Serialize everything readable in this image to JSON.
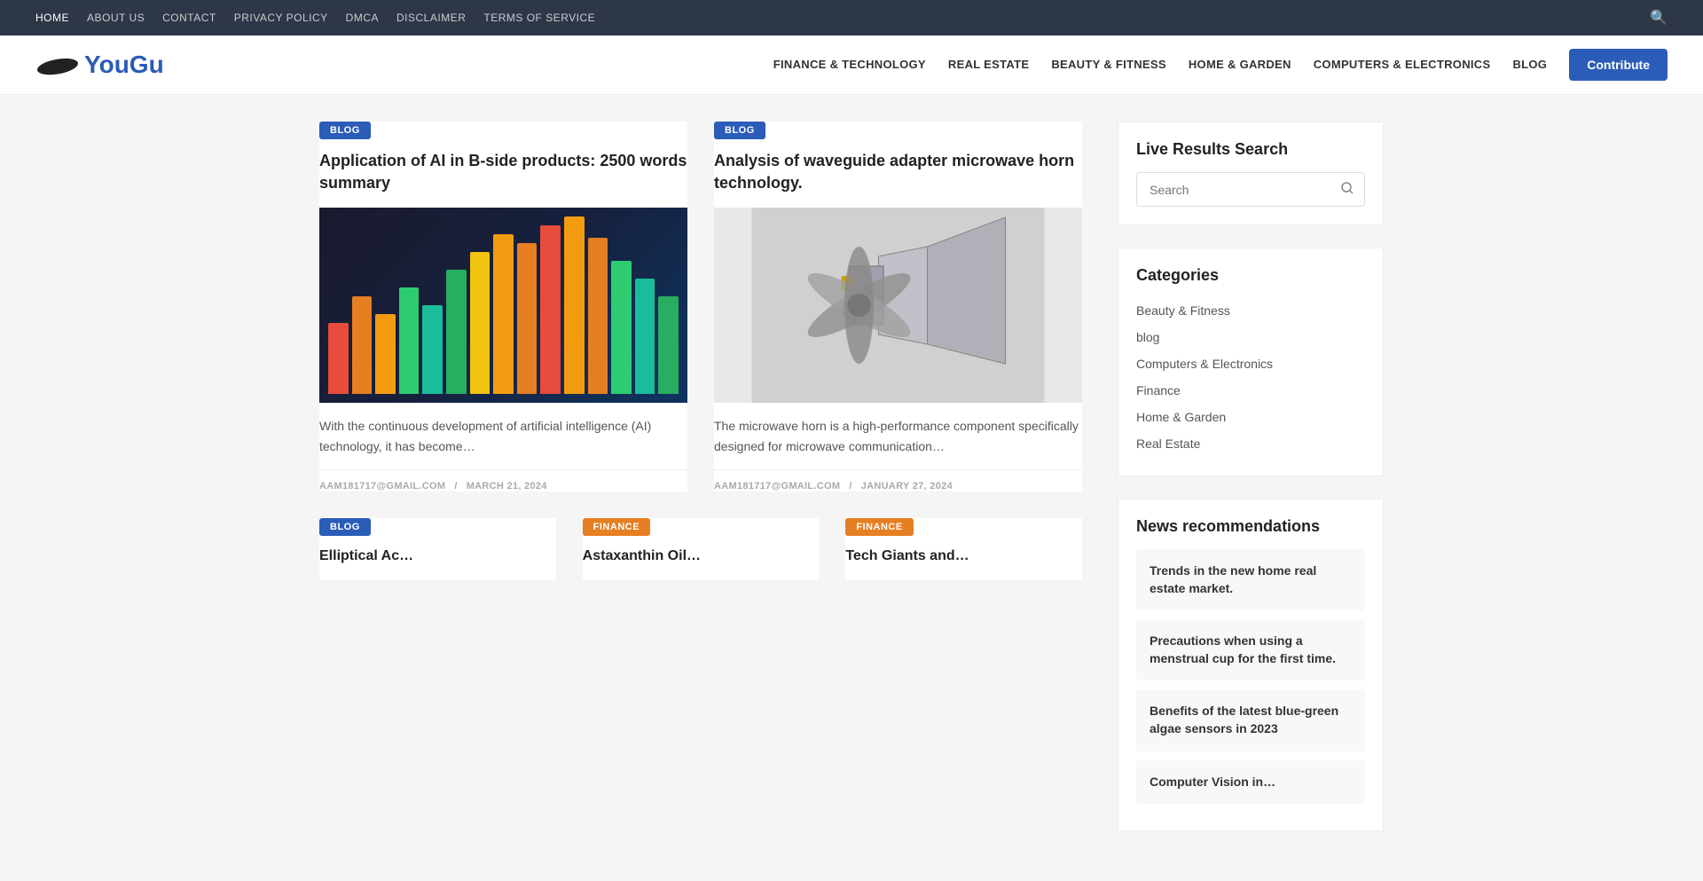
{
  "topnav": {
    "links": [
      {
        "label": "HOME",
        "href": "#",
        "active": true
      },
      {
        "label": "ABOUT US",
        "href": "#",
        "active": false
      },
      {
        "label": "CONTACT",
        "href": "#",
        "active": false
      },
      {
        "label": "PRIVACY POLICY",
        "href": "#",
        "active": false
      },
      {
        "label": "DMCA",
        "href": "#",
        "active": false
      },
      {
        "label": "DISCLAIMER",
        "href": "#",
        "active": false
      },
      {
        "label": "TERMS OF SERVICE",
        "href": "#",
        "active": false
      }
    ]
  },
  "header": {
    "logo_text": "YouGu",
    "nav_items": [
      {
        "label": "FINANCE & TECHNOLOGY",
        "href": "#"
      },
      {
        "label": "REAL ESTATE",
        "href": "#"
      },
      {
        "label": "BEAUTY & FITNESS",
        "href": "#"
      },
      {
        "label": "HOME & GARDEN",
        "href": "#"
      },
      {
        "label": "COMPUTERS & ELECTRONICS",
        "href": "#"
      },
      {
        "label": "BLOG",
        "href": "#"
      }
    ],
    "contribute_label": "Contribute"
  },
  "articles": {
    "top": [
      {
        "badge": "BLOG",
        "badge_type": "blog",
        "title": "Application of AI in B-side products: 2500 words summary",
        "excerpt": "With the continuous development of artificial intelligence (AI) technology, it has become…",
        "author": "AAM181717@GMAIL.COM",
        "date": "MARCH 21, 2024"
      },
      {
        "badge": "BLOG",
        "badge_type": "blog",
        "title": "Analysis of waveguide adapter microwave horn technology.",
        "excerpt": "The microwave horn is a high-performance component specifically designed for microwave communication…",
        "author": "AAM181717@GMAIL.COM",
        "date": "JANUARY 27, 2024"
      }
    ],
    "bottom": [
      {
        "badge": "BLOG",
        "badge_type": "blog",
        "title": "Elliptical Ac…"
      },
      {
        "badge": "FINANCE",
        "badge_type": "finance",
        "title": "Astaxanthin Oil…"
      },
      {
        "badge": "FINANCE",
        "badge_type": "finance",
        "title": "Tech Giants and…"
      }
    ]
  },
  "sidebar": {
    "search": {
      "title": "Live Results Search",
      "placeholder": "Search"
    },
    "categories": {
      "title": "Categories",
      "items": [
        {
          "label": "Beauty & Fitness",
          "href": "#"
        },
        {
          "label": "blog",
          "href": "#"
        },
        {
          "label": "Computers & Electronics",
          "href": "#"
        },
        {
          "label": "Finance",
          "href": "#"
        },
        {
          "label": "Home & Garden",
          "href": "#"
        },
        {
          "label": "Real Estate",
          "href": "#"
        }
      ]
    },
    "news_rec": {
      "title": "News recommendations",
      "items": [
        {
          "title": "Trends in the new home real estate market."
        },
        {
          "title": "Precautions when using a menstrual cup for the first time."
        },
        {
          "title": "Benefits of the latest blue-green algae sensors in 2023"
        },
        {
          "title": "Computer Vision in…"
        }
      ]
    }
  }
}
